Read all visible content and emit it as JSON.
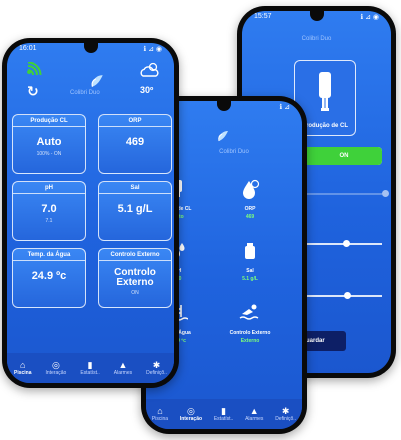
{
  "phone_left": {
    "status_time": "16:01",
    "status_right": "ℹ ⊿ ◉",
    "app_name": "Colibri Duo",
    "temperature": "30º",
    "cards": [
      {
        "title": "Produção CL",
        "value": "Auto",
        "sub": "100% - ON"
      },
      {
        "title": "ORP",
        "value": "469",
        "sub": ""
      },
      {
        "title": "pH",
        "value": "7.0",
        "sub": "7.1"
      },
      {
        "title": "Sal",
        "value": "5.1 g/L",
        "sub": ""
      },
      {
        "title": "Temp. da Água",
        "value": "24.9 ºc",
        "sub": ""
      },
      {
        "title": "Controlo Externo",
        "value": "Controlo Externo",
        "sub": "ON"
      }
    ],
    "nav": [
      "Piscina",
      "Interação",
      "Estatíst..",
      "Alarmes",
      "Definiçõ.."
    ]
  },
  "phone_middle": {
    "status_right": "ℹ ⊿",
    "app_name": "Colibri Duo",
    "tiles": [
      {
        "label": "ução de CL",
        "value": "Auto"
      },
      {
        "label": "ORP",
        "value": "469"
      },
      {
        "label": "pH",
        "value": "7.0"
      },
      {
        "label": "Sal",
        "value": "5.1 g/L"
      },
      {
        "label": "p. da Água",
        "value": "25.0 ºc"
      },
      {
        "label": "Controlo Externo",
        "value": "Externo"
      }
    ],
    "nav": [
      "Piscina",
      "Interação",
      "Estatíst..",
      "Alarmes",
      "Definiçõ.."
    ]
  },
  "phone_right": {
    "status_time": "15:57",
    "status_right": "ℹ ⊿ ◉",
    "app_name": "Colibri Duo",
    "device_label": "Produção de CL",
    "toggle_on": "ON",
    "save_button": "Guardar"
  },
  "colors": {
    "accent_green": "#3fd13a",
    "value_green": "#7dff7a",
    "navy_button": "#0d1f66"
  }
}
